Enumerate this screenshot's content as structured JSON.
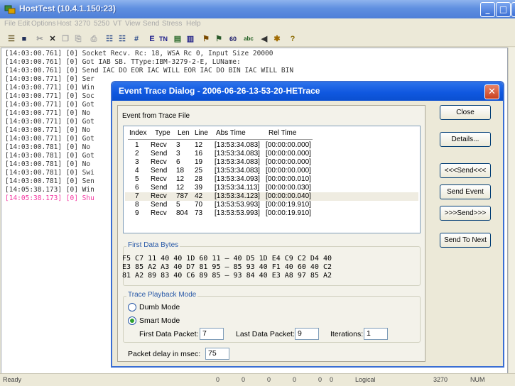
{
  "window": {
    "title": "HostTest (10.4.1.150:23)"
  },
  "menu": [
    "File",
    "Edit",
    "Options",
    "Host",
    "3270",
    "5250",
    "VT",
    "View",
    "Send",
    "Stress",
    "Help"
  ],
  "toolbar_icons": [
    "new-icon",
    "save-icon",
    "cut-icon",
    "delete-icon",
    "copy-icon",
    "paste-icon",
    "print-icon",
    "grid-a-icon",
    "grid-b-icon",
    "grid-c-icon",
    "e-icon",
    "tn-icon",
    "packet-a-icon",
    "packet-b-icon",
    "find-icon",
    "chart-icon",
    "sixty-icon",
    "abc-icon",
    "sound-icon",
    "tools-icon",
    "help-icon"
  ],
  "log_lines": [
    "[14:03:00.761] [0] Socket Recv. Rc: 18, WSA Rc 0, Input Size 20000",
    "[14:03:00.761] [0] Got IAB SB. TType:IBM-3279-2-E, LUName:",
    "[14:03:00.761] [0] Send IAC DO EOR IAC WILL EOR IAC DO BIN IAC WILL BIN",
    "[14:03:00.771] [0] Ser",
    "[14:03:00.771] [0] Win",
    "[14:03:00.771] [0] Soc",
    "[14:03:00.771] [0] Got",
    "[14:03:00.771] [0] No",
    "[14:03:00.771] [0] Got",
    "[14:03:00.771] [0] No",
    "[14:03:00.771] [0] Got",
    "[14:03:00.781] [0] No",
    "[14:03:00.781] [0] Got",
    "[14:03:00.781] [0] No",
    "[14:03:00.781] [0] Swi",
    "[14:03:00.781] [0] Sen",
    "[14:05:38.173] [0] Win",
    "[14:05:38.173] [0] Shu"
  ],
  "status": {
    "ready": "Ready",
    "n1": "0",
    "n2": "0",
    "n3": "0",
    "n4": "0",
    "n5": "0",
    "n6": "0",
    "mode": "Logical",
    "port": "3270",
    "num": "NUM"
  },
  "dialog": {
    "title": "Event Trace Dialog - 2006-06-26-13-53-20-HETrace",
    "section_label": "Event from Trace File",
    "columns": [
      "Index",
      "Type",
      "Len",
      "Line",
      "Abs Time",
      "Rel Time"
    ],
    "rows": [
      [
        "1",
        "Recv",
        "3",
        "12",
        "[13:53:34.083]",
        "[00:00:00.000]"
      ],
      [
        "2",
        "Send",
        "3",
        "16",
        "[13:53:34.083]",
        "[00:00:00.000]"
      ],
      [
        "3",
        "Recv",
        "6",
        "19",
        "[13:53:34.083]",
        "[00:00:00.000]"
      ],
      [
        "4",
        "Send",
        "18",
        "25",
        "[13:53:34.083]",
        "[00:00:00.000]"
      ],
      [
        "5",
        "Recv",
        "12",
        "28",
        "[13:53:34.093]",
        "[00:00:00.010]"
      ],
      [
        "6",
        "Send",
        "12",
        "39",
        "[13:53:34.113]",
        "[00:00:00.030]"
      ],
      [
        "7",
        "Recv",
        "787",
        "42",
        "[13:53:34.123]",
        "[00:00:00.040]"
      ],
      [
        "8",
        "Send",
        "5",
        "70",
        "[13:53:53.993]",
        "[00:00:19.910]"
      ],
      [
        "9",
        "Recv",
        "804",
        "73",
        "[13:53:53.993]",
        "[00:00:19.910]"
      ]
    ],
    "first_bytes_label": "First Data Bytes",
    "first_bytes": [
      "F5 C7 11 40 40 1D 60 11 – 40 D5 1D E4 C9 C2 D4 40",
      "E3 85 A2 A3 40 D7 81 95 – 85 93 40 F1 40 60 40 C2",
      "81 A2 89 83 40 C6 89 85 – 93 84 40 E3 A8 97 85 A2"
    ],
    "playback_label": "Trace Playback Mode",
    "dumb_mode": "Dumb Mode",
    "smart_mode": "Smart Mode",
    "first_packet_label": "First Data Packet:",
    "first_packet_value": "7",
    "last_packet_label": "Last Data Packet:",
    "last_packet_value": "9",
    "iterations_label": "Iterations:",
    "iterations_value": "1",
    "delay_label": "Packet delay in msec:",
    "delay_value": "75",
    "buttons": {
      "close": "Close",
      "details": "Details...",
      "send_back": "<<<Send<<<",
      "send_event": "Send Event",
      "send_fwd": ">>>Send>>>",
      "send_to_next": "Send To Next"
    }
  }
}
